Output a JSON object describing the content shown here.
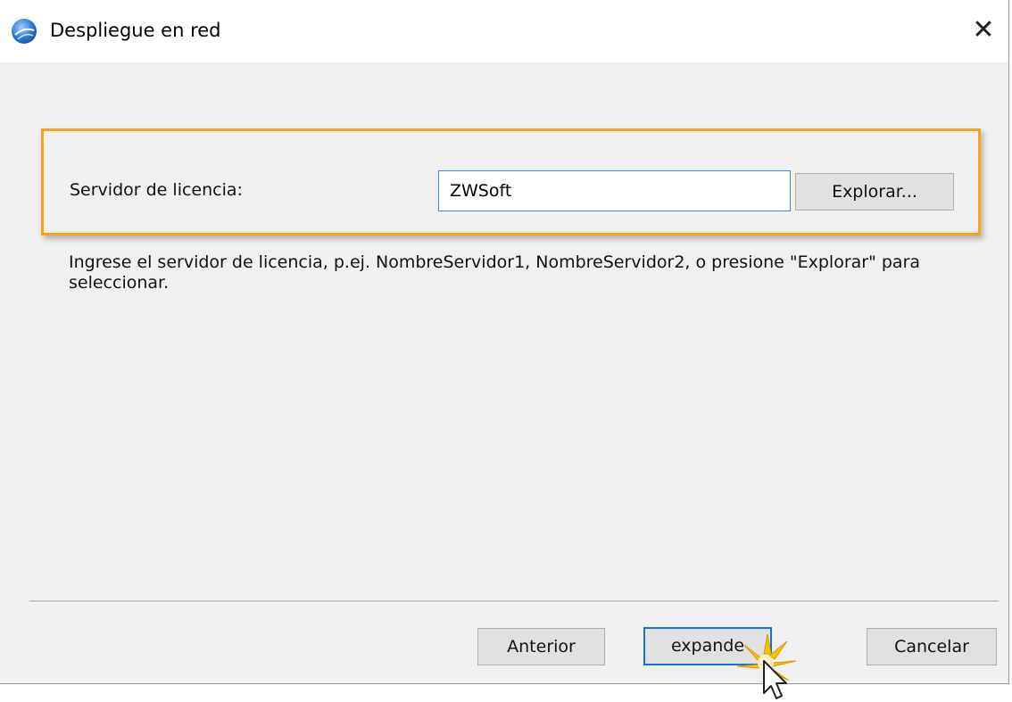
{
  "window": {
    "title": "Despliegue en red",
    "app_icon": "globe-icon",
    "close_icon": "close-icon",
    "close_glyph": "✕"
  },
  "license": {
    "label": "Servidor de licencia:",
    "value": "ZWSoft",
    "browse_label": "Explorar...",
    "hint": "Ingrese el servidor de licencia, p.ej. NombreServidor1, NombreServidor2, o presione \"Explorar\" para seleccionar."
  },
  "footer": {
    "prev_label": "Anterior",
    "next_label": "expande",
    "cancel_label": "Cancelar"
  },
  "colors": {
    "highlight": "#f7a21b",
    "focus": "#1a6fd1"
  }
}
